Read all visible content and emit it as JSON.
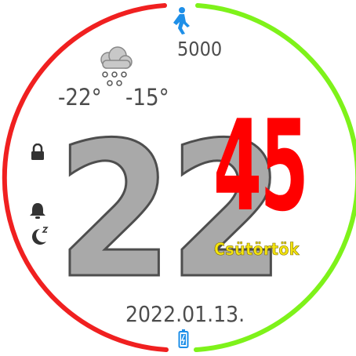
{
  "watchface": {
    "steps": "5000",
    "temp_low": "-22°",
    "temp_high": "-15°",
    "hours": "22",
    "minutes": "45",
    "weekday": "Csütörtök",
    "date": "2022.01.13."
  },
  "colors": {
    "ring_left": "#f02020",
    "ring_right": "#7ef21a",
    "minutes": "#ff0000",
    "hours_fill": "#a9a9a9",
    "weekday": "#f5e50e",
    "accent_blue": "#1e8fe8"
  },
  "icons": [
    "walking-person-icon",
    "snow-cloud-icon",
    "lock-icon",
    "bell-icon",
    "moon-sleep-icon",
    "battery-icon"
  ]
}
